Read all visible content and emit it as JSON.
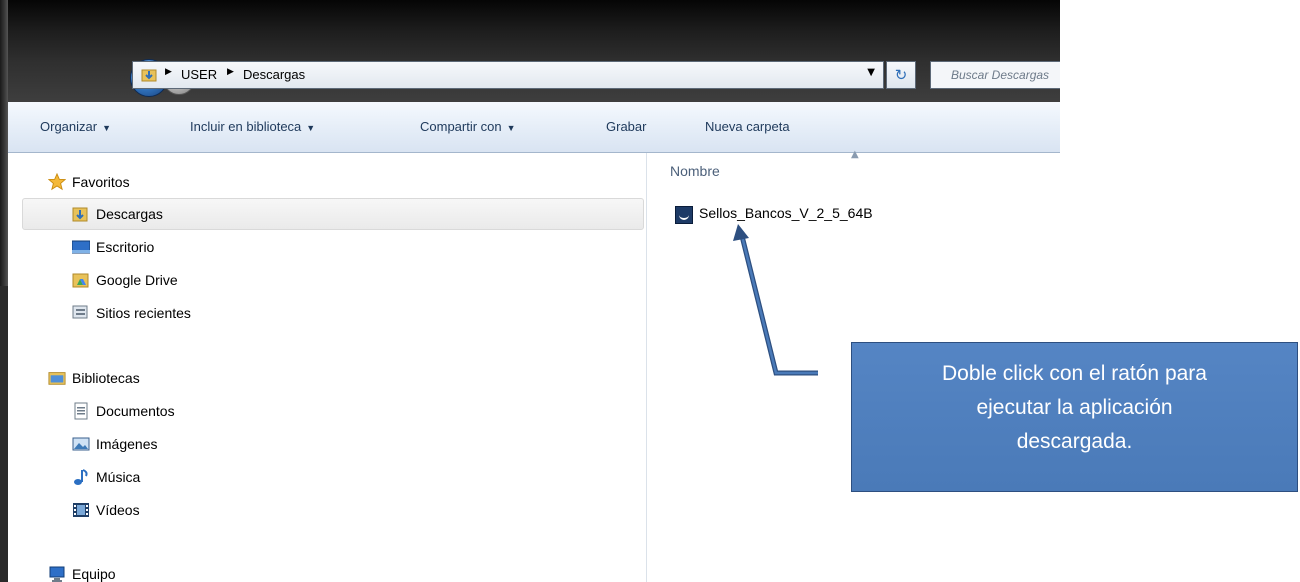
{
  "address": {
    "crumbs": [
      "USER",
      "Descargas"
    ],
    "search_placeholder": "Buscar Descargas"
  },
  "toolbar": {
    "organize": "Organizar",
    "include": "Incluir en biblioteca",
    "share": "Compartir con",
    "burn": "Grabar",
    "new_folder": "Nueva carpeta"
  },
  "nav": {
    "favorites": "Favoritos",
    "downloads": "Descargas",
    "desktop": "Escritorio",
    "google_drive": "Google Drive",
    "recent": "Sitios recientes",
    "libraries": "Bibliotecas",
    "documents": "Documentos",
    "images": "Imágenes",
    "music": "Música",
    "videos": "Vídeos",
    "computer": "Equipo"
  },
  "content": {
    "column_name": "Nombre",
    "file_name": "Sellos_Bancos_V_2_5_64B"
  },
  "callout": {
    "line1": "Doble click con el ratón para",
    "line2": "ejecutar la aplicación",
    "line3": "descargada."
  },
  "colors": {
    "callout_bg": "#4a7ab8",
    "arrow": "#2d4f80",
    "toolbar_text": "#1e395b"
  }
}
